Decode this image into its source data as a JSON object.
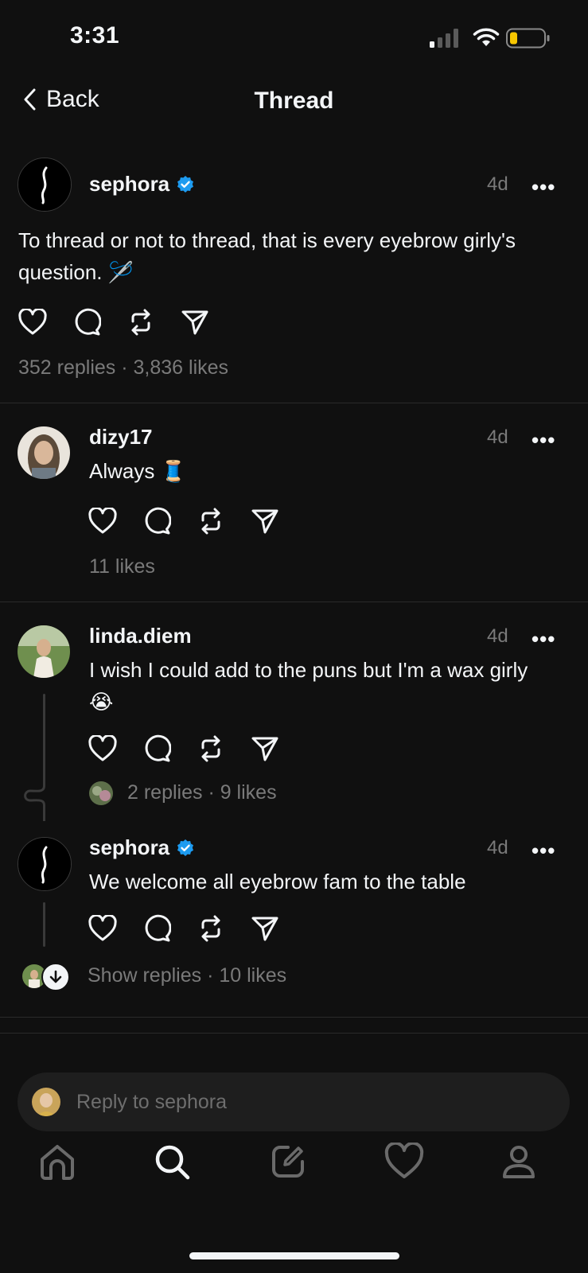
{
  "status_bar": {
    "time": "3:31"
  },
  "nav": {
    "back_label": "Back",
    "title": "Thread"
  },
  "main_post": {
    "username": "sephora",
    "verified": true,
    "timestamp": "4d",
    "more": "•••",
    "text": "To thread or not to thread, that is every eyebrow girly's question. 🪡",
    "meta": "352 replies · 3,836 likes"
  },
  "replies": [
    {
      "username": "dizy17",
      "timestamp": "4d",
      "more": "•••",
      "text": "Always 🧵",
      "meta": "11 likes"
    },
    {
      "username": "linda.diem",
      "timestamp": "4d",
      "more": "•••",
      "text": "I wish I could add to the puns but I'm a wax girly 😭",
      "meta": "2 replies · 9 likes"
    },
    {
      "username": "sephora",
      "verified": true,
      "timestamp": "4d",
      "more": "•••",
      "text": "We welcome all eyebrow fam to the table",
      "meta": "Show replies · 10 likes"
    }
  ],
  "reply_box": {
    "placeholder": "Reply to sephora"
  },
  "tab_bar": {
    "tabs": [
      "home-icon",
      "search-icon",
      "compose-icon",
      "heart-icon",
      "profile-icon"
    ],
    "active": "search-icon"
  },
  "colors": {
    "background": "#101010",
    "text": "#f3f5f7",
    "muted": "#7a7a7a",
    "verified": "#1d9bf0",
    "battery_low": "#f7c600"
  }
}
